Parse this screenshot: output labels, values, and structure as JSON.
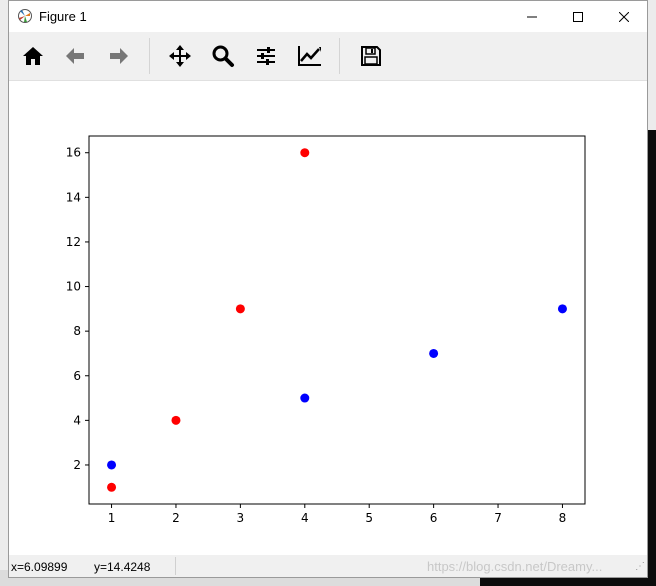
{
  "window": {
    "title": "Figure 1"
  },
  "toolbar": {
    "tools": [
      "home-icon",
      "back-arrow-icon",
      "forward-arrow-icon",
      "pan-icon",
      "zoom-icon",
      "configure-subplots-icon",
      "edit-axis-icon",
      "save-icon"
    ]
  },
  "status": {
    "x": "x=6.09899",
    "y": "y=14.4248"
  },
  "watermark": "https://blog.csdn.net/Dreamy...",
  "colors": {
    "series_red": "#ff0000",
    "series_blue": "#0000ff"
  },
  "chart_data": {
    "type": "scatter",
    "title": "",
    "xlabel": "",
    "ylabel": "",
    "xlim": [
      0.65,
      8.35
    ],
    "ylim": [
      0.25,
      16.75
    ],
    "xticks": [
      1,
      2,
      3,
      4,
      5,
      6,
      7,
      8
    ],
    "yticks": [
      2,
      4,
      6,
      8,
      10,
      12,
      14,
      16
    ],
    "grid": false,
    "series": [
      {
        "color": "#ff0000",
        "x": [
          1,
          2,
          3,
          4
        ],
        "y": [
          1,
          4,
          9,
          16
        ]
      },
      {
        "color": "#0000ff",
        "x": [
          1,
          4,
          6,
          8
        ],
        "y": [
          2,
          5,
          7,
          9
        ]
      }
    ]
  }
}
